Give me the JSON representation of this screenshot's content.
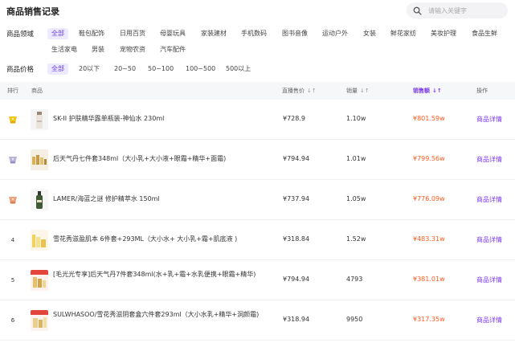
{
  "header": {
    "title": "商品销售记录"
  },
  "search": {
    "placeholder": "请输入关键字"
  },
  "filters": {
    "domain_label": "商品领域",
    "domains": [
      "全部",
      "鞋包配饰",
      "日用百货",
      "母婴玩具",
      "家装建材",
      "手机数码",
      "图书音像",
      "运动户外",
      "女装",
      "鲜花家纺",
      "美妆护理",
      "食品生鲜",
      "生活家电",
      "男装",
      "宠物农资",
      "汽车配件"
    ],
    "price_label": "商品价格",
    "prices": [
      "全部",
      "20以下",
      "20~50",
      "50~100",
      "100~500",
      "500以上"
    ],
    "active_domain": "全部",
    "active_price": "全部"
  },
  "table": {
    "headers": {
      "rank": "排行",
      "product": "商品",
      "price": "直播售价",
      "volume": "销量",
      "sales": "销售额",
      "action": "操作"
    },
    "sorted_column": "sales",
    "rows": [
      {
        "rank": "",
        "badge": "gold",
        "name": "SK-II 护肤精华露单瓶装-神仙水 230ml",
        "price": "¥728.9",
        "volume": "1.10w",
        "sales": "¥801.59w",
        "action": "商品详情"
      },
      {
        "rank": "",
        "badge": "silver",
        "name": "后天气丹七件套348ml（大小乳+大小液+眼霜+精华+面霜)",
        "price": "¥794.94",
        "volume": "1.01w",
        "sales": "¥799.56w",
        "action": "商品详情"
      },
      {
        "rank": "",
        "badge": "bronze",
        "name": "LAMER/海蓝之谜 修护精萃水 150ml",
        "price": "¥737.94",
        "volume": "1.05w",
        "sales": "¥776.09w",
        "action": "商品详情"
      },
      {
        "rank": "4",
        "badge": "",
        "name": "雪花秀滋盈肌本 6件套+293ML（大小水+ 大小乳+霜+肌底液 )",
        "price": "¥318.84",
        "volume": "1.52w",
        "sales": "¥483.31w",
        "action": "商品详情"
      },
      {
        "rank": "5",
        "badge": "",
        "name": "[毛光光专享]后天气丹7件套348ml(水+乳+霜+水乳便携+眼霜+精华)",
        "price": "¥794.94",
        "volume": "4793",
        "sales": "¥381.01w",
        "action": "商品详情"
      },
      {
        "rank": "6",
        "badge": "",
        "name": "SULWHASOO/雪花秀滋阴套盒六件套293ml（大小水乳+精华+洞颜霜)",
        "price": "¥318.94",
        "volume": "9950",
        "sales": "¥317.35w",
        "action": "商品详情"
      }
    ]
  },
  "colors": {
    "accent": "#7c3aed",
    "sales": "#ff5a1f",
    "gold": "#f5c518",
    "silver": "#b6b3d9",
    "bronze": "#f2a07b"
  }
}
